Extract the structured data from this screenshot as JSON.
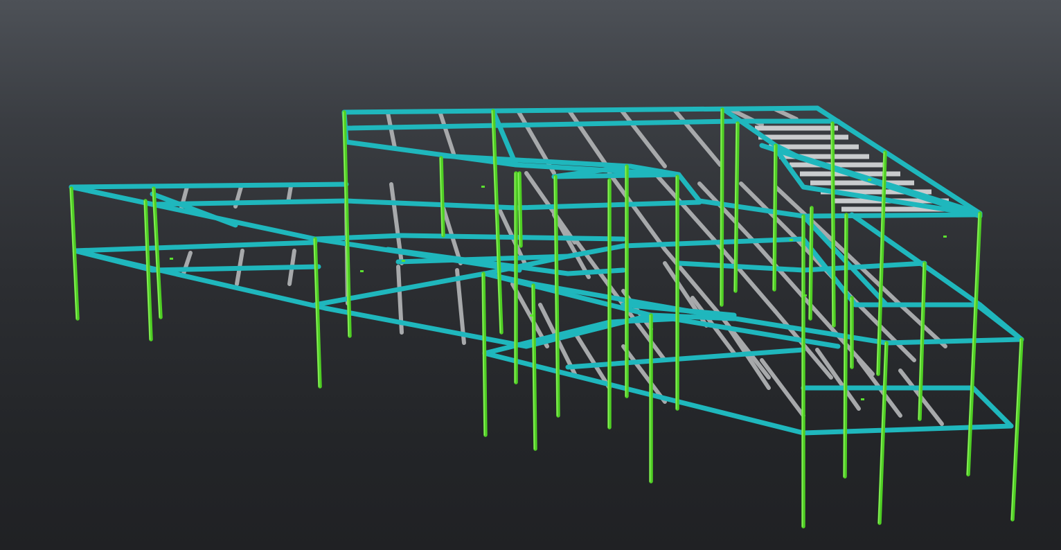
{
  "viewport": {
    "background_top": "#4d5157",
    "background_bottom": "#202124"
  },
  "model": {
    "beam_color": "#1fb7bd",
    "column_color": "#4fcf24",
    "joist_color": "#a7a9ab"
  }
}
